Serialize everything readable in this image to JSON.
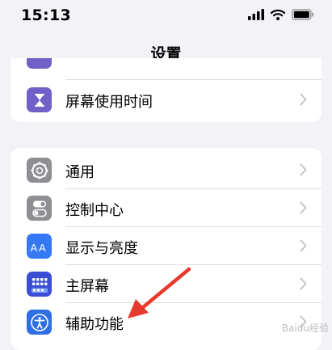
{
  "status_bar": {
    "time": "15:13"
  },
  "nav": {
    "title": "设置"
  },
  "top_group": [
    {
      "label": "屏幕使用时间",
      "icon": "hourglass-icon",
      "color": "#6f61c8"
    }
  ],
  "main_group": [
    {
      "label": "通用",
      "icon": "gear-icon",
      "color": "#8e8e93"
    },
    {
      "label": "控制中心",
      "icon": "toggles-icon",
      "color": "#8e8e93"
    },
    {
      "label": "显示与亮度",
      "icon": "text-size-icon",
      "color": "#3478f6"
    },
    {
      "label": "主屏幕",
      "icon": "app-grid-icon",
      "color": "#3a4fd3"
    },
    {
      "label": "辅助功能",
      "icon": "accessibility-icon",
      "color": "#2f6fe4"
    }
  ],
  "watermark": "Baidu经验"
}
